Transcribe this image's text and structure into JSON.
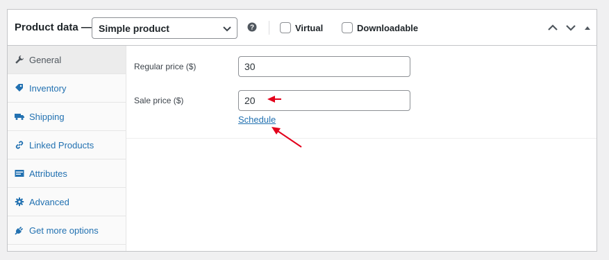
{
  "header": {
    "title": "Product data —",
    "product_type": "Simple product",
    "virtual_label": "Virtual",
    "virtual_checked": false,
    "downloadable_label": "Downloadable",
    "downloadable_checked": false
  },
  "tabs": [
    {
      "label": "General",
      "icon": "wrench-icon",
      "active": true
    },
    {
      "label": "Inventory",
      "icon": "tag-icon",
      "active": false
    },
    {
      "label": "Shipping",
      "icon": "truck-icon",
      "active": false
    },
    {
      "label": "Linked Products",
      "icon": "link-icon",
      "active": false
    },
    {
      "label": "Attributes",
      "icon": "list-icon",
      "active": false
    },
    {
      "label": "Advanced",
      "icon": "gear-icon",
      "active": false
    },
    {
      "label": "Get more options",
      "icon": "plugin-icon",
      "active": false
    }
  ],
  "general": {
    "regular_price_label": "Regular price ($)",
    "regular_price_value": "30",
    "sale_price_label": "Sale price ($)",
    "sale_price_value": "20",
    "schedule_link": "Schedule"
  },
  "colors": {
    "accent": "#2271b1",
    "annotation_arrow": "#e3001b"
  }
}
